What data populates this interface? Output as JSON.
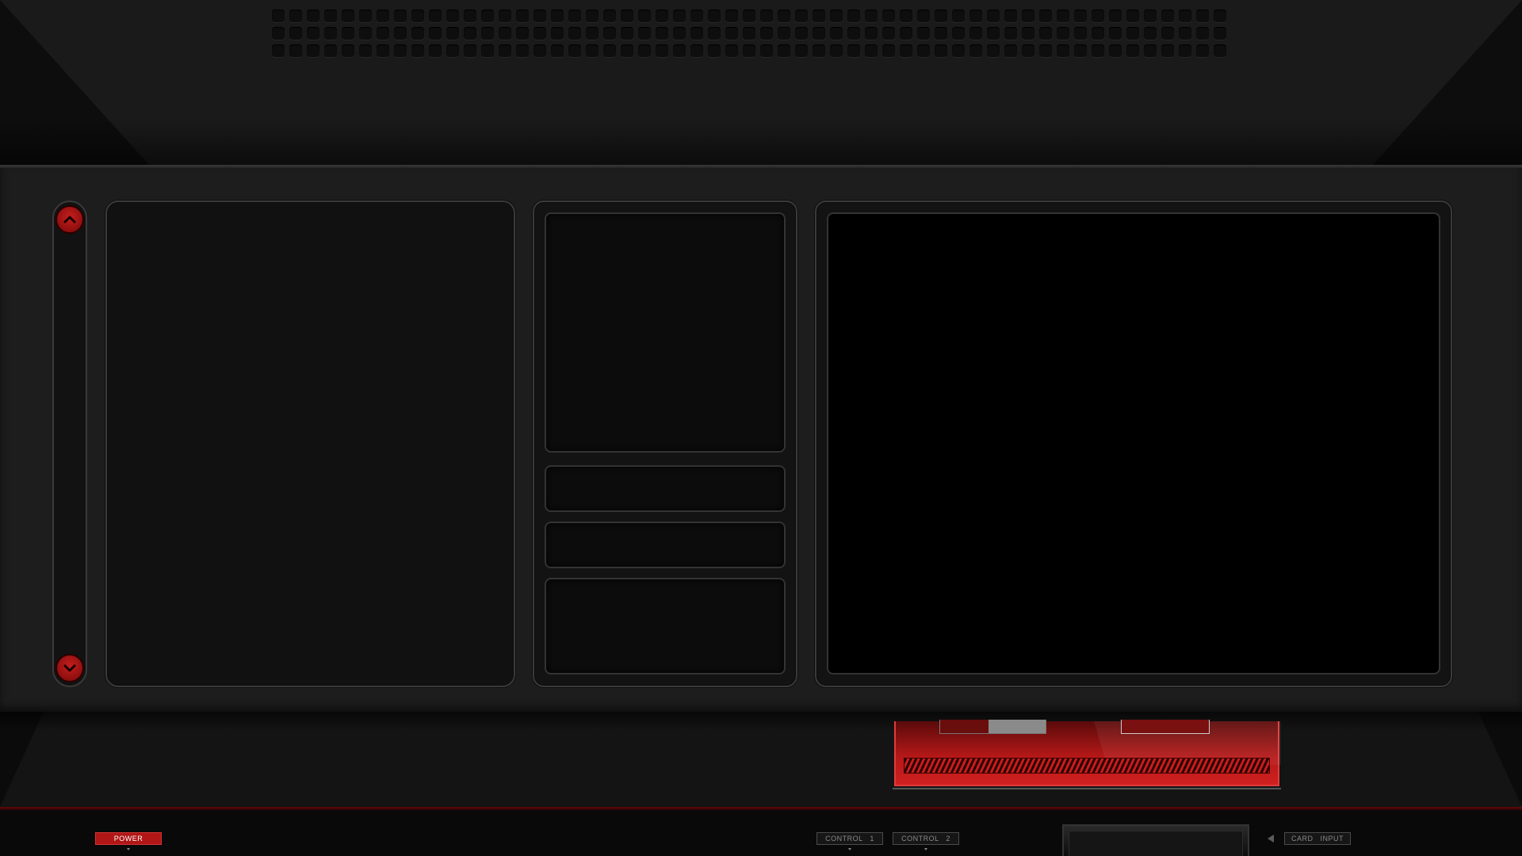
{
  "controls": {
    "power_label": "POWER",
    "control1_label": "CONTROL   1",
    "control2_label": "CONTROL   2",
    "card_input_label": "CARD   INPUT"
  },
  "colors": {
    "accent": "#b01616",
    "panel_border": "#3a3a3a",
    "background": "#1d1d1d"
  },
  "icons": {
    "scroll_up": "chevron-up-icon",
    "scroll_down": "chevron-down-icon",
    "card_arrow": "triangle-left-icon"
  }
}
